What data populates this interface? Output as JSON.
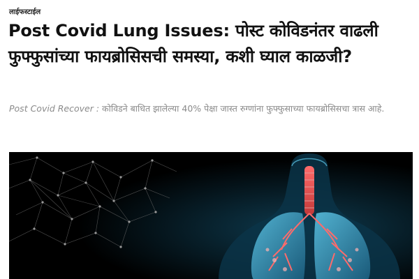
{
  "article": {
    "category": "लाईफस्टाईल",
    "headline": "Post Covid Lung Issues: पोस्ट कोविडनंतर वाढली फुफ्फुसांच्या फायब्रोसिसची समस्या, कशी घ्याल काळजी?",
    "summary_lead": "Post Covid Recover :",
    "summary_text": " कोविडने बाधित झालेल्या 40% पेक्षा जास्त रुग्णांना फुफ्फुसाच्या फायब्रोसिसचा त्रास आहे."
  },
  "hero_image": {
    "subject": "lungs-illustration",
    "background_color": "#000000",
    "accent_colors": [
      "#4fc3e8",
      "#e25a5a",
      "#1a6a8a"
    ]
  }
}
